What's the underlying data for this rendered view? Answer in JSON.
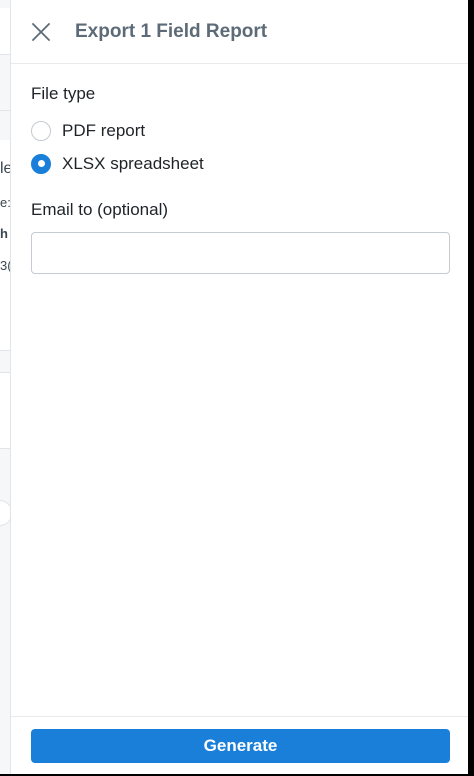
{
  "background": {
    "fragments": [
      "le",
      "e:",
      "h",
      "3("
    ]
  },
  "panel": {
    "title": "Export 1 Field Report",
    "close_icon": "close-icon"
  },
  "file_type": {
    "label": "File type",
    "options": [
      {
        "label": "PDF report",
        "selected": false
      },
      {
        "label": "XLSX spreadsheet",
        "selected": true
      }
    ]
  },
  "email": {
    "label": "Email to (optional)",
    "value": "",
    "placeholder": ""
  },
  "footer": {
    "generate_label": "Generate"
  },
  "colors": {
    "accent": "#1a7fd8",
    "title": "#5d6b78"
  }
}
